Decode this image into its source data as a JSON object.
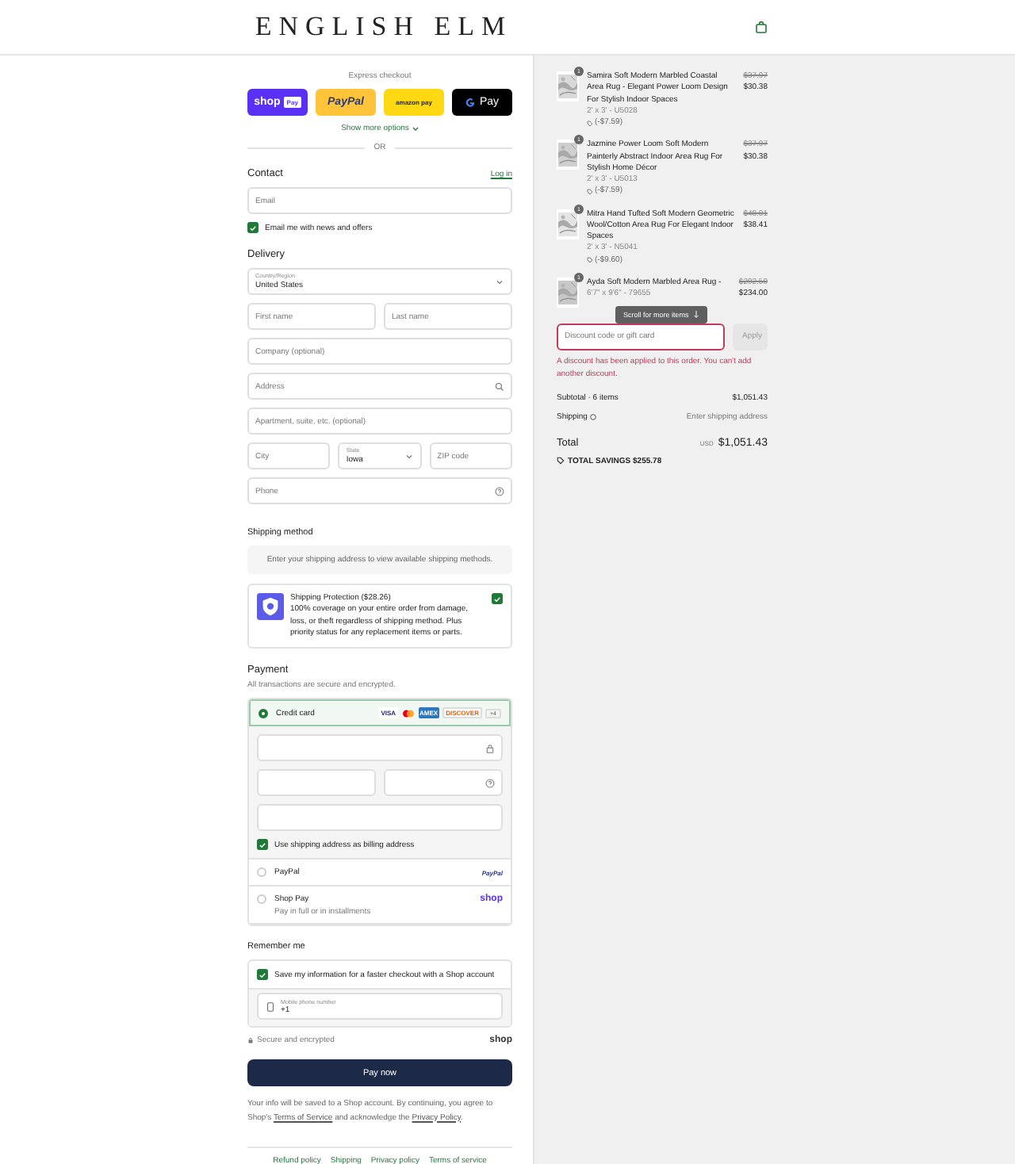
{
  "header": {
    "brand": "ENGLISH ELM"
  },
  "express": {
    "title": "Express checkout",
    "buttons": [
      {
        "kind": "shop",
        "label": "shop",
        "badge": "Pay"
      },
      {
        "kind": "paypal",
        "label": "PayPal"
      },
      {
        "kind": "amazon",
        "label": "amazon pay"
      },
      {
        "kind": "gpay",
        "label": "Pay"
      }
    ],
    "more": "Show more options",
    "divider": "OR"
  },
  "contact": {
    "title": "Contact",
    "login": "Log in",
    "email": {
      "placeholder": "Email"
    },
    "newsletter": {
      "label": "Email me with news and offers",
      "checked": true
    }
  },
  "delivery": {
    "title": "Delivery",
    "rows": [
      [
        {
          "kind": "select",
          "label": "Country/Region",
          "value": "United States"
        }
      ],
      [
        {
          "kind": "text",
          "placeholder": "First name"
        },
        {
          "kind": "text",
          "placeholder": "Last name"
        }
      ],
      [
        {
          "kind": "text",
          "placeholder": "Company (optional)"
        }
      ],
      [
        {
          "kind": "address",
          "placeholder": "Address"
        }
      ],
      [
        {
          "kind": "text",
          "placeholder": "Apartment, suite, etc. (optional)"
        }
      ],
      [
        {
          "kind": "text",
          "placeholder": "City"
        },
        {
          "kind": "select",
          "label": "State",
          "value": "Iowa"
        },
        {
          "kind": "text",
          "placeholder": "ZIP code"
        }
      ],
      [
        {
          "kind": "phone",
          "placeholder": "Phone"
        }
      ]
    ]
  },
  "shipping_method": {
    "title": "Shipping method",
    "notice": "Enter your shipping address to view available shipping methods."
  },
  "protection": {
    "title": "Shipping Protection ($28.26)",
    "text": "100% coverage on your entire order from damage, loss, or theft regardless of shipping method. Plus priority status for any replacement items or parts.",
    "checked": true
  },
  "payment": {
    "title": "Payment",
    "subtitle": "All transactions are secure and encrypted.",
    "methods": [
      {
        "kind": "card",
        "label": "Credit card",
        "selected": true,
        "brands": [
          {
            "kind": "visa",
            "label": "VISA"
          },
          {
            "kind": "mastercard"
          },
          {
            "kind": "amex",
            "label": "AMEX"
          },
          {
            "kind": "discover",
            "label": "DISCOVER"
          }
        ],
        "more": "+4"
      },
      {
        "kind": "paypal",
        "label": "PayPal",
        "selected": false,
        "logo": "PayPal"
      },
      {
        "kind": "shop",
        "label": "Shop Pay",
        "sublabel": "Pay in full or in installments",
        "selected": false,
        "logo": "shop"
      }
    ],
    "billing": {
      "label": "Use shipping address as billing address",
      "checked": true
    }
  },
  "remember": {
    "title": "Remember me",
    "save": {
      "label": "Save my information for a faster checkout with a Shop account",
      "checked": true
    },
    "phone": {
      "label": "Mobile phone number",
      "value": "+1"
    },
    "secure": "Secure and encrypted",
    "logo": "shop"
  },
  "pay_button": "Pay now",
  "consent": {
    "before": "Your info will be saved to a Shop account. By continuing, you agree to Shop's",
    "terms_link": "Terms of Service",
    "middle": "and acknowledge the",
    "privacy_link": "Privacy Policy",
    "after": "."
  },
  "footer_links": [
    "Refund policy",
    "Shipping",
    "Privacy policy",
    "Terms of service"
  ],
  "summary": {
    "items": [
      {
        "quantity": "1",
        "title": "Samira Soft Modern Marbled Coastal Area Rug - Elegant Power Loom Design For Stylish Indoor Spaces",
        "variant": "2' x 3' - U5028",
        "savings": "(-$7.59)",
        "compare_price": "$37.97",
        "price": "$30.38"
      },
      {
        "quantity": "1",
        "title": "Jazmine Power Loom Soft Modern Painterly Abstract Indoor Area Rug For Stylish Home Décor",
        "variant": "2' x 3' - U5013",
        "savings": "(-$7.59)",
        "compare_price": "$37.97",
        "price": "$30.38"
      },
      {
        "quantity": "1",
        "title": "Mitra Hand Tufted Soft Modern Geometric Wool/Cotton Area Rug For Elegant Indoor Spaces",
        "variant": "2' x 3' - N5041",
        "savings": "(-$9.60)",
        "compare_price": "$48.01",
        "price": "$38.41"
      },
      {
        "quantity": "1",
        "title": "Ayda Soft Modern Marbled Area Rug -",
        "variant": "6'7\" x 9'6\" - 79655",
        "compare_price": "$292.50",
        "price": "$234.00"
      }
    ],
    "scroll_hint": "Scroll for more items",
    "discount": {
      "placeholder": "Discount code or gift card",
      "apply": "Apply",
      "error": "A discount has been applied to this order. You can't add another discount."
    },
    "subtotal": {
      "label": "Subtotal · 6 items",
      "value": "$1,051.43"
    },
    "shipping": {
      "label": "Shipping",
      "value": "Enter shipping address"
    },
    "total": {
      "label": "Total",
      "currency": "USD",
      "value": "$1,051.43"
    },
    "savings": "TOTAL SAVINGS $255.78"
  }
}
